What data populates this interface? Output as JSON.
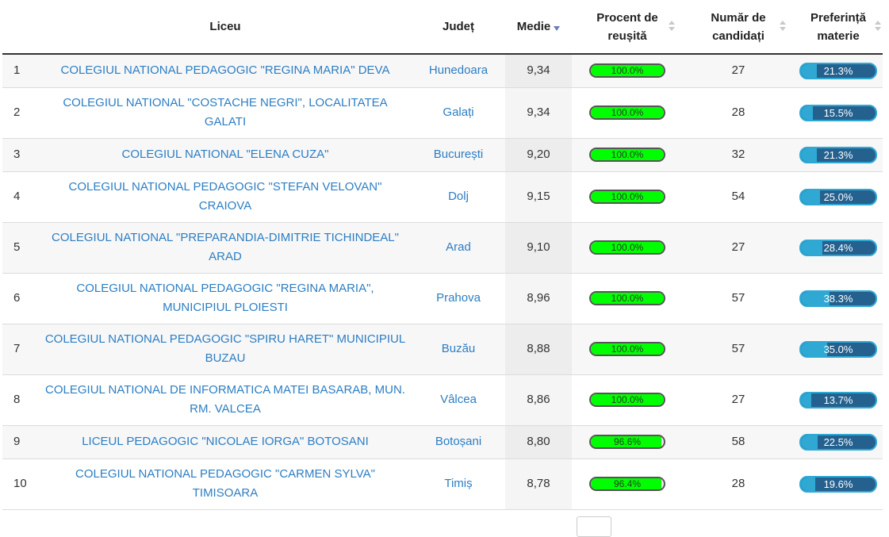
{
  "columns": {
    "rank": "",
    "liceu": "Liceu",
    "judet": "Județ",
    "medie": "Medie",
    "procent_line1": "Procent de",
    "procent_line2": "reușită",
    "candidati_line1": "Număr de",
    "candidati_line2": "candidați",
    "pref_line1": "Preferință",
    "pref_line2": "materie"
  },
  "colors": {
    "link": "#2c7ec4",
    "success_fill": "#00ff00",
    "pref_fill": "#2fa8d4",
    "pref_track": "#24618f"
  },
  "rows": [
    {
      "rank": "1",
      "liceu": "COLEGIUL NATIONAL PEDAGOGIC \"REGINA MARIA\" DEVA",
      "judet": "Hunedoara",
      "medie": "9,34",
      "procent": "100.0%",
      "procent_value": 100.0,
      "candidati": "27",
      "pref": "21.3%",
      "pref_value": 21.3
    },
    {
      "rank": "2",
      "liceu": "COLEGIUL NATIONAL \"COSTACHE NEGRI\", LOCALITATEA GALATI",
      "judet": "Galați",
      "medie": "9,34",
      "procent": "100.0%",
      "procent_value": 100.0,
      "candidati": "28",
      "pref": "15.5%",
      "pref_value": 15.5
    },
    {
      "rank": "3",
      "liceu": "COLEGIUL NATIONAL \"ELENA CUZA\"",
      "judet": "București",
      "medie": "9,20",
      "procent": "100.0%",
      "procent_value": 100.0,
      "candidati": "32",
      "pref": "21.3%",
      "pref_value": 21.3
    },
    {
      "rank": "4",
      "liceu": "COLEGIUL NATIONAL PEDAGOGIC \"STEFAN VELOVAN\" CRAIOVA",
      "judet": "Dolj",
      "medie": "9,15",
      "procent": "100.0%",
      "procent_value": 100.0,
      "candidati": "54",
      "pref": "25.0%",
      "pref_value": 25.0
    },
    {
      "rank": "5",
      "liceu": "COLEGIUL NATIONAL \"PREPARANDIA-DIMITRIE TICHINDEAL\" ARAD",
      "judet": "Arad",
      "medie": "9,10",
      "procent": "100.0%",
      "procent_value": 100.0,
      "candidati": "27",
      "pref": "28.4%",
      "pref_value": 28.4
    },
    {
      "rank": "6",
      "liceu": "COLEGIUL NATIONAL PEDAGOGIC \"REGINA MARIA\", MUNICIPIUL PLOIESTI",
      "judet": "Prahova",
      "medie": "8,96",
      "procent": "100.0%",
      "procent_value": 100.0,
      "candidati": "57",
      "pref": "38.3%",
      "pref_value": 38.3
    },
    {
      "rank": "7",
      "liceu": "COLEGIUL NATIONAL PEDAGOGIC \"SPIRU HARET\" MUNICIPIUL BUZAU",
      "judet": "Buzău",
      "medie": "8,88",
      "procent": "100.0%",
      "procent_value": 100.0,
      "candidati": "57",
      "pref": "35.0%",
      "pref_value": 35.0
    },
    {
      "rank": "8",
      "liceu": "COLEGIUL NATIONAL DE INFORMATICA MATEI BASARAB, MUN. RM. VALCEA",
      "judet": "Vâlcea",
      "medie": "8,86",
      "procent": "100.0%",
      "procent_value": 100.0,
      "candidati": "27",
      "pref": "13.7%",
      "pref_value": 13.7
    },
    {
      "rank": "9",
      "liceu": "LICEUL PEDAGOGIC \"NICOLAE IORGA\" BOTOSANI",
      "judet": "Botoșani",
      "medie": "8,80",
      "procent": "96.6%",
      "procent_value": 96.6,
      "candidati": "58",
      "pref": "22.5%",
      "pref_value": 22.5
    },
    {
      "rank": "10",
      "liceu": "COLEGIUL NATIONAL PEDAGOGIC \"CARMEN SYLVA\" TIMISOARA",
      "judet": "Timiș",
      "medie": "8,78",
      "procent": "96.4%",
      "procent_value": 96.4,
      "candidati": "28",
      "pref": "19.6%",
      "pref_value": 19.6
    }
  ]
}
